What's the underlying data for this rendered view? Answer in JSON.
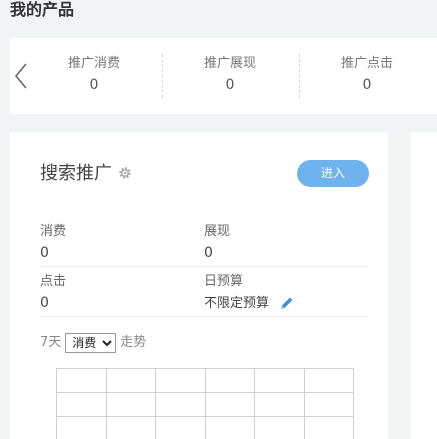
{
  "page": {
    "title": "我的产品"
  },
  "stats_strip": {
    "items": [
      {
        "label": "推广消费",
        "value": "0"
      },
      {
        "label": "推广展现",
        "value": "0"
      },
      {
        "label": "推广点击",
        "value": "0"
      }
    ]
  },
  "card": {
    "title": "搜索推广",
    "enter_label": "进入",
    "metrics": {
      "spend": {
        "label": "消费",
        "value": "0"
      },
      "impressions": {
        "label": "展现",
        "value": "0"
      },
      "clicks": {
        "label": "点击",
        "value": "0"
      },
      "daily_budget": {
        "label": "日预算",
        "value": "不限定预算"
      }
    },
    "trend": {
      "days": "7天",
      "selected": "消费",
      "suffix": "走势"
    }
  },
  "colors": {
    "accent": "#6fb3ee",
    "pencil": "#3d8fe0",
    "background": "#f2f3f5"
  },
  "icons": {
    "prev": "chevron-left-icon",
    "settings": "gear-icon",
    "edit": "pencil-icon"
  }
}
